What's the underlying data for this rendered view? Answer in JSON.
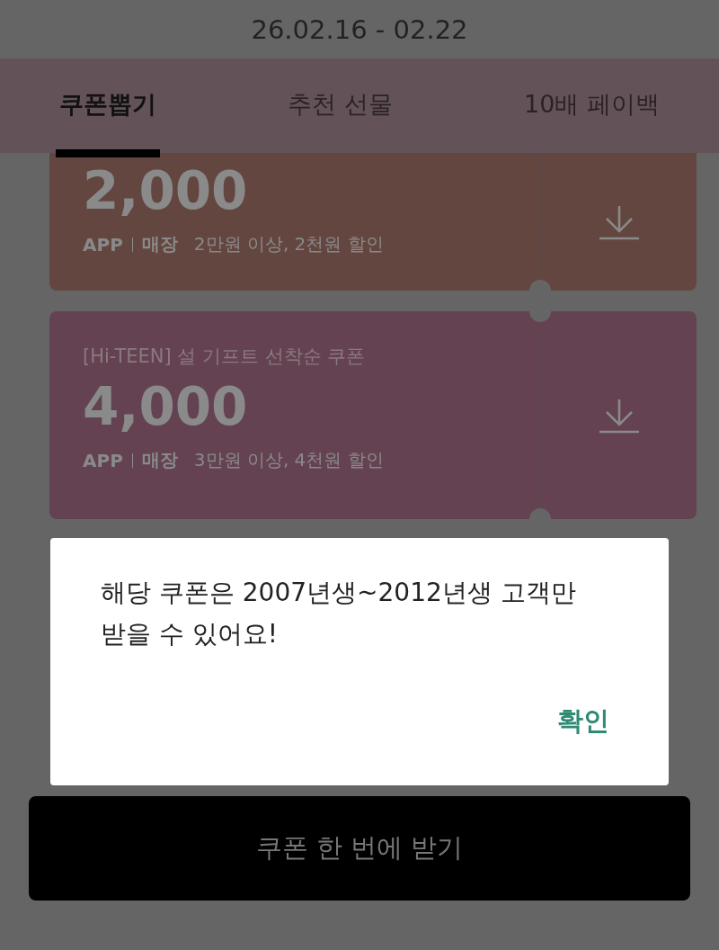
{
  "period": "26.02.16 - 02.22",
  "tabs": [
    {
      "label": "쿠폰뽑기",
      "selected": true
    },
    {
      "label": "추천 선물",
      "selected": false
    },
    {
      "label": "10배 페이백",
      "selected": false
    }
  ],
  "coupons": [
    {
      "amount": "2,000",
      "channels": [
        "APP",
        "매장"
      ],
      "condition": "2만원 이상, 2천원 할인",
      "color": "#644640"
    },
    {
      "title": "[Hi-TEEN] 설 기프트 선착순 쿠폰",
      "amount": "4,000",
      "channels": [
        "APP",
        "매장"
      ],
      "condition": "3만원 이상, 4천원 할인",
      "color": "#644252"
    }
  ],
  "dialog": {
    "message": "해당 쿠폰은 2007년생~2012년생 고객만 받을 수 있어요!",
    "confirm": "확인"
  },
  "bottom_button": "쿠폰 한 번에 받기"
}
